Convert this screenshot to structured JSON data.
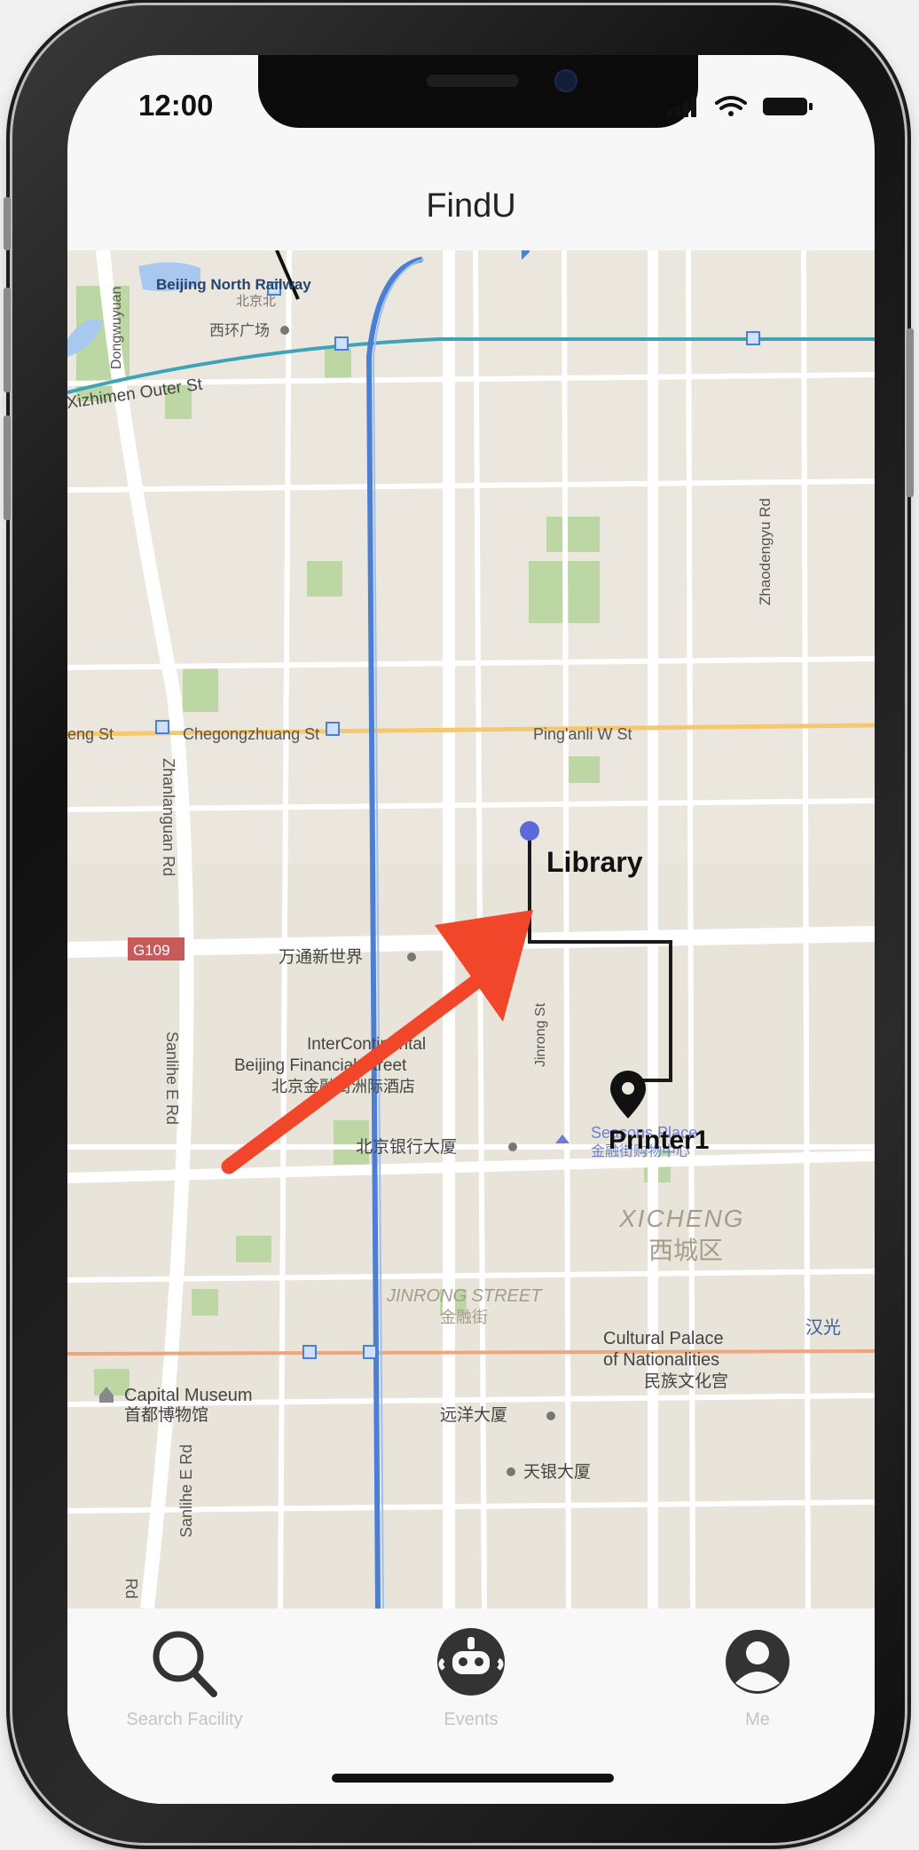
{
  "status_bar": {
    "time": "12:00"
  },
  "header": {
    "title": "FindU"
  },
  "map": {
    "labels": {
      "beijing_north_railway": "Beijing North Railway",
      "beijing_north_cn": "北京北",
      "xihuan_plaza": "西环广场",
      "dongwuyuan": "Dongwuyuan",
      "xizhimen_outer_st": "Xizhimen Outer St",
      "zhaodengyu_rd": "Zhaodengyu Rd",
      "eng_st": "eng St",
      "chegongzhuang_st": "Chegongzhuang St",
      "pinganli_w_st": "Ping'anli W St",
      "zhanlanguan_rd": "Zhanlanguan Rd",
      "g109": "G109",
      "wantong": "万通新世界",
      "intercontinental_1": "InterContinental",
      "intercontinental_2": "Beijing Financial Street",
      "intercontinental_cn": "北京金融街洲际酒店",
      "sanlihe_e_rd_1": "Sanlihe E Rd",
      "sanlihe_e_rd_2": "Sanlihe E Rd",
      "jinrong_st": "Jinrong St",
      "bank_building": "北京银行大厦",
      "seasons_place": "Seasons Place",
      "seasons_place_cn": "金融街购物中心",
      "xicheng": "XICHENG",
      "xicheng_cn": "西城区",
      "jinrong_street": "JINRONG STREET",
      "jinrong_street_cn": "金融街",
      "cultural_palace_1": "Cultural Palace",
      "cultural_palace_2": "of Nationalities",
      "cultural_palace_cn": "民族文化宫",
      "hanguang": "汉光",
      "capital_museum": "Capital Museum",
      "capital_museum_cn": "首都博物馆",
      "yuanyang": "远洋大厦",
      "tianyin": "天银大厦",
      "rd_edge": "Rd"
    },
    "route": {
      "start_label": "Library",
      "end_label": "Printer1"
    },
    "colors": {
      "route": "#1a1a1a",
      "start_dot": "#5a6ad8",
      "arrow": "#f2462a",
      "metro_line": "#4a7fd4"
    }
  },
  "tab_bar": {
    "items": [
      {
        "label": "Search Facility",
        "icon": "search-icon"
      },
      {
        "label": "Events",
        "icon": "events-icon"
      },
      {
        "label": "Me",
        "icon": "profile-icon"
      }
    ]
  }
}
